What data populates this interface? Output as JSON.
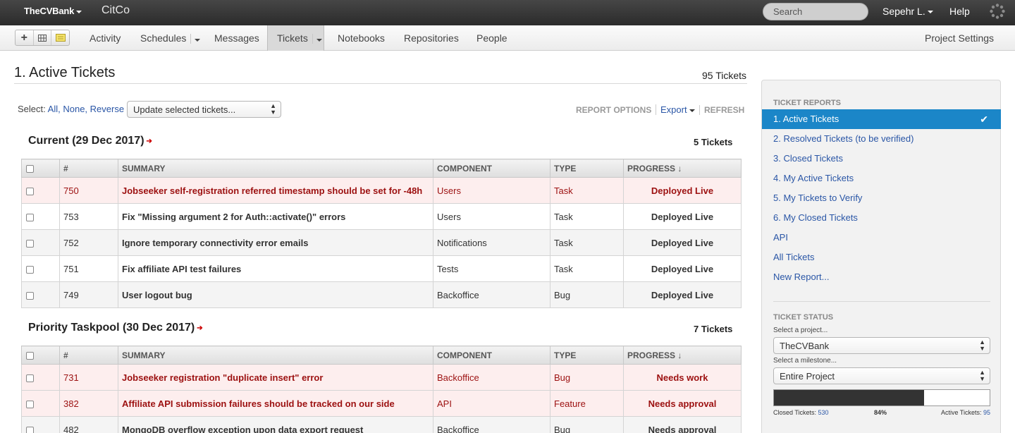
{
  "topbar": {
    "account": "TheCVBank",
    "project": "CitCo",
    "search_placeholder": "Search",
    "user": "Sepehr L.",
    "help": "Help"
  },
  "nav": {
    "items": [
      "Activity",
      "Schedules",
      "Messages",
      "Tickets",
      "Notebooks",
      "Repositories",
      "People"
    ],
    "active": "Tickets",
    "project_settings": "Project Settings"
  },
  "report": {
    "title": "1. Active Tickets",
    "count": "95 Tickets",
    "select_label": "Select:",
    "select_all": "All,",
    "select_none": "None,",
    "select_reverse": "Reverse",
    "update_select": "Update selected tickets...",
    "report_options": "REPORT OPTIONS",
    "export": "Export",
    "refresh": "REFRESH"
  },
  "columns": [
    "#",
    "SUMMARY",
    "COMPONENT",
    "TYPE",
    "PROGRESS ↓"
  ],
  "groups": [
    {
      "title": "Current (29 Dec 2017)",
      "count": "5 Tickets",
      "rows": [
        {
          "id": "750",
          "summary": "Jobseeker self-registration referred timestamp should be set for -48h",
          "component": "Users",
          "type": "Task",
          "progress": "Deployed Live"
        },
        {
          "id": "753",
          "summary": "Fix \"Missing argument 2 for Auth::activate()\" errors",
          "component": "Users",
          "type": "Task",
          "progress": "Deployed Live"
        },
        {
          "id": "752",
          "summary": "Ignore temporary connectivity error emails",
          "component": "Notifications",
          "type": "Task",
          "progress": "Deployed Live"
        },
        {
          "id": "751",
          "summary": "Fix affiliate API test failures",
          "component": "Tests",
          "type": "Task",
          "progress": "Deployed Live"
        },
        {
          "id": "749",
          "summary": "User logout bug",
          "component": "Backoffice",
          "type": "Bug",
          "progress": "Deployed Live"
        }
      ]
    },
    {
      "title": "Priority Taskpool (30 Dec 2017)",
      "count": "7 Tickets",
      "rows": [
        {
          "id": "731",
          "summary": "Jobseeker registration \"duplicate insert\" error",
          "component": "Backoffice",
          "type": "Bug",
          "progress": "Needs work"
        },
        {
          "id": "382",
          "summary": "Affiliate API submission failures should be tracked on our side",
          "component": "API",
          "type": "Feature",
          "progress": "Needs approval"
        },
        {
          "id": "482",
          "summary": "MongoDB overflow exception upon data export request",
          "component": "Backoffice",
          "type": "Bug",
          "progress": "Needs approval"
        }
      ]
    }
  ],
  "sidebar": {
    "reports_heading": "TICKET REPORTS",
    "reports": [
      "1. Active Tickets",
      "2. Resolved Tickets (to be verified)",
      "3. Closed Tickets",
      "4. My Active Tickets",
      "5. My Tickets to Verify",
      "6. My Closed Tickets",
      "API",
      "All Tickets",
      "New Report..."
    ],
    "status_heading": "TICKET STATUS",
    "project_label": "Select a project...",
    "project_value": "TheCVBank",
    "milestone_label": "Select a milestone...",
    "milestone_value": "Entire Project",
    "progress_fraction": 0.84,
    "closed_label": "Closed Tickets:",
    "closed_value": "530",
    "percent": "84%",
    "active_label": "Active Tickets:",
    "active_value": "95"
  },
  "colors": {
    "accent": "#1b86c8",
    "hot_row_bg": "#fdeeee",
    "hot_row_text": "#9c1010",
    "topbar": "#333333"
  }
}
